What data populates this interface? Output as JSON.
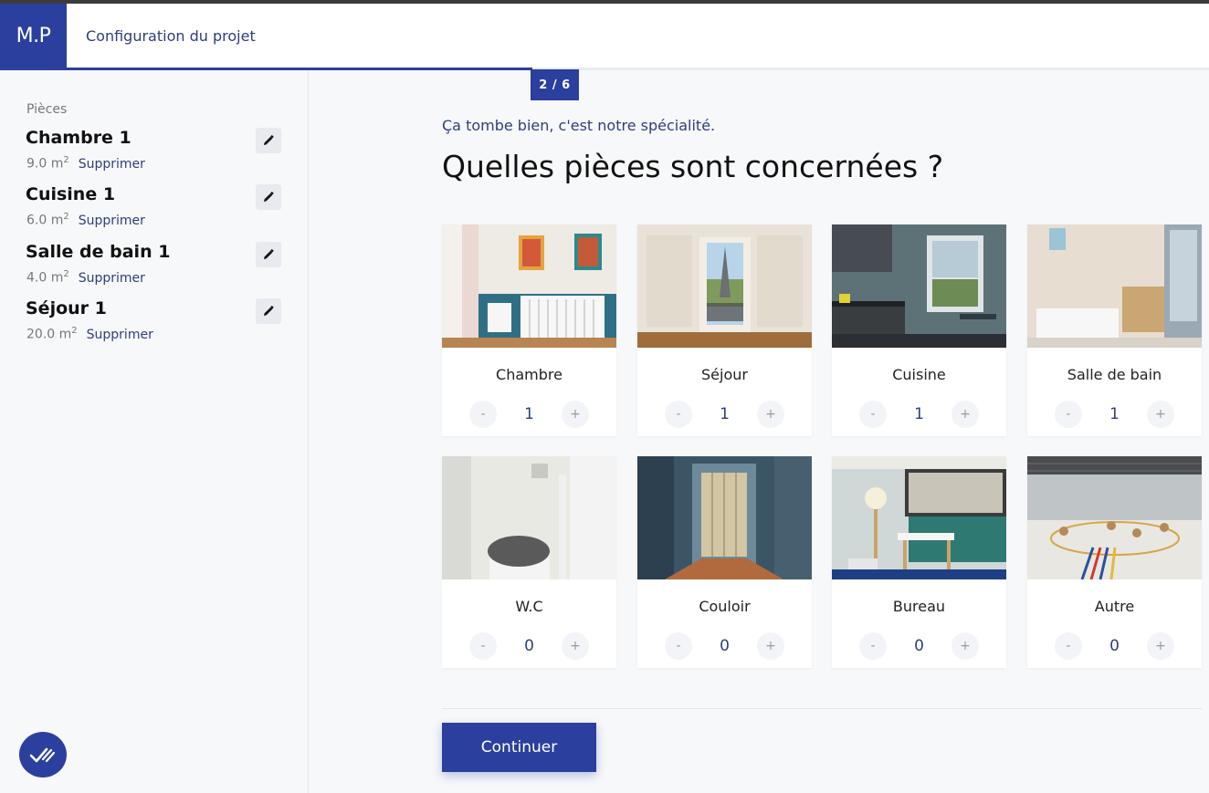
{
  "header": {
    "logo": "M.P",
    "title": "Configuration du projet",
    "step": "2 / 6",
    "progress": 0.44
  },
  "sidebar": {
    "heading": "Pièces",
    "rooms": [
      {
        "name": "Chambre 1",
        "area": "9.0 m",
        "unit": "2",
        "delete": "Supprimer"
      },
      {
        "name": "Cuisine 1",
        "area": "6.0 m",
        "unit": "2",
        "delete": "Supprimer"
      },
      {
        "name": "Salle de bain 1",
        "area": "4.0 m",
        "unit": "2",
        "delete": "Supprimer"
      },
      {
        "name": "Séjour 1",
        "area": "20.0 m",
        "unit": "2",
        "delete": "Supprimer"
      }
    ]
  },
  "main": {
    "subtitle": "Ça tombe bien, c'est notre spécialité.",
    "question": "Quelles pièces sont concernées ?",
    "cards": [
      {
        "label": "Chambre",
        "count": "1",
        "minus": "-",
        "plus": "+"
      },
      {
        "label": "Séjour",
        "count": "1",
        "minus": "-",
        "plus": "+"
      },
      {
        "label": "Cuisine",
        "count": "1",
        "minus": "-",
        "plus": "+"
      },
      {
        "label": "Salle de bain",
        "count": "1",
        "minus": "-",
        "plus": "+"
      },
      {
        "label": "W.C",
        "count": "0",
        "minus": "-",
        "plus": "+"
      },
      {
        "label": "Couloir",
        "count": "0",
        "minus": "-",
        "plus": "+"
      },
      {
        "label": "Bureau",
        "count": "0",
        "minus": "-",
        "plus": "+"
      },
      {
        "label": "Autre",
        "count": "0",
        "minus": "-",
        "plus": "+"
      }
    ],
    "continue": "Continuer"
  },
  "colors": {
    "brand": "#2b3f9e",
    "link": "#2f3e7d"
  }
}
